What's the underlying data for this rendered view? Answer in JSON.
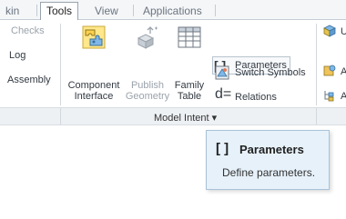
{
  "tabs": [
    {
      "label": "kin"
    },
    {
      "label": "Tools"
    },
    {
      "label": "View"
    },
    {
      "label": "Applications"
    }
  ],
  "left_column": {
    "checks": "Checks",
    "log": "Log",
    "assembly": "Assembly"
  },
  "buttons": {
    "component_interface": {
      "line1": "Component",
      "line2": "Interface"
    },
    "publish_geometry": {
      "line1": "Publish",
      "line2": "Geometry"
    },
    "family_table": {
      "line1": "Family",
      "line2": "Table"
    }
  },
  "small_buttons": {
    "parameters": "Parameters",
    "switch_symbols": "Switch Symbols",
    "relations": "Relations"
  },
  "right_partial": {
    "item1": "U",
    "item2": "A",
    "item3": "A"
  },
  "group": {
    "label": "Model Intent ▾"
  },
  "tooltip": {
    "icon_text": "[ ]",
    "title": "Parameters",
    "description": "Define parameters."
  }
}
